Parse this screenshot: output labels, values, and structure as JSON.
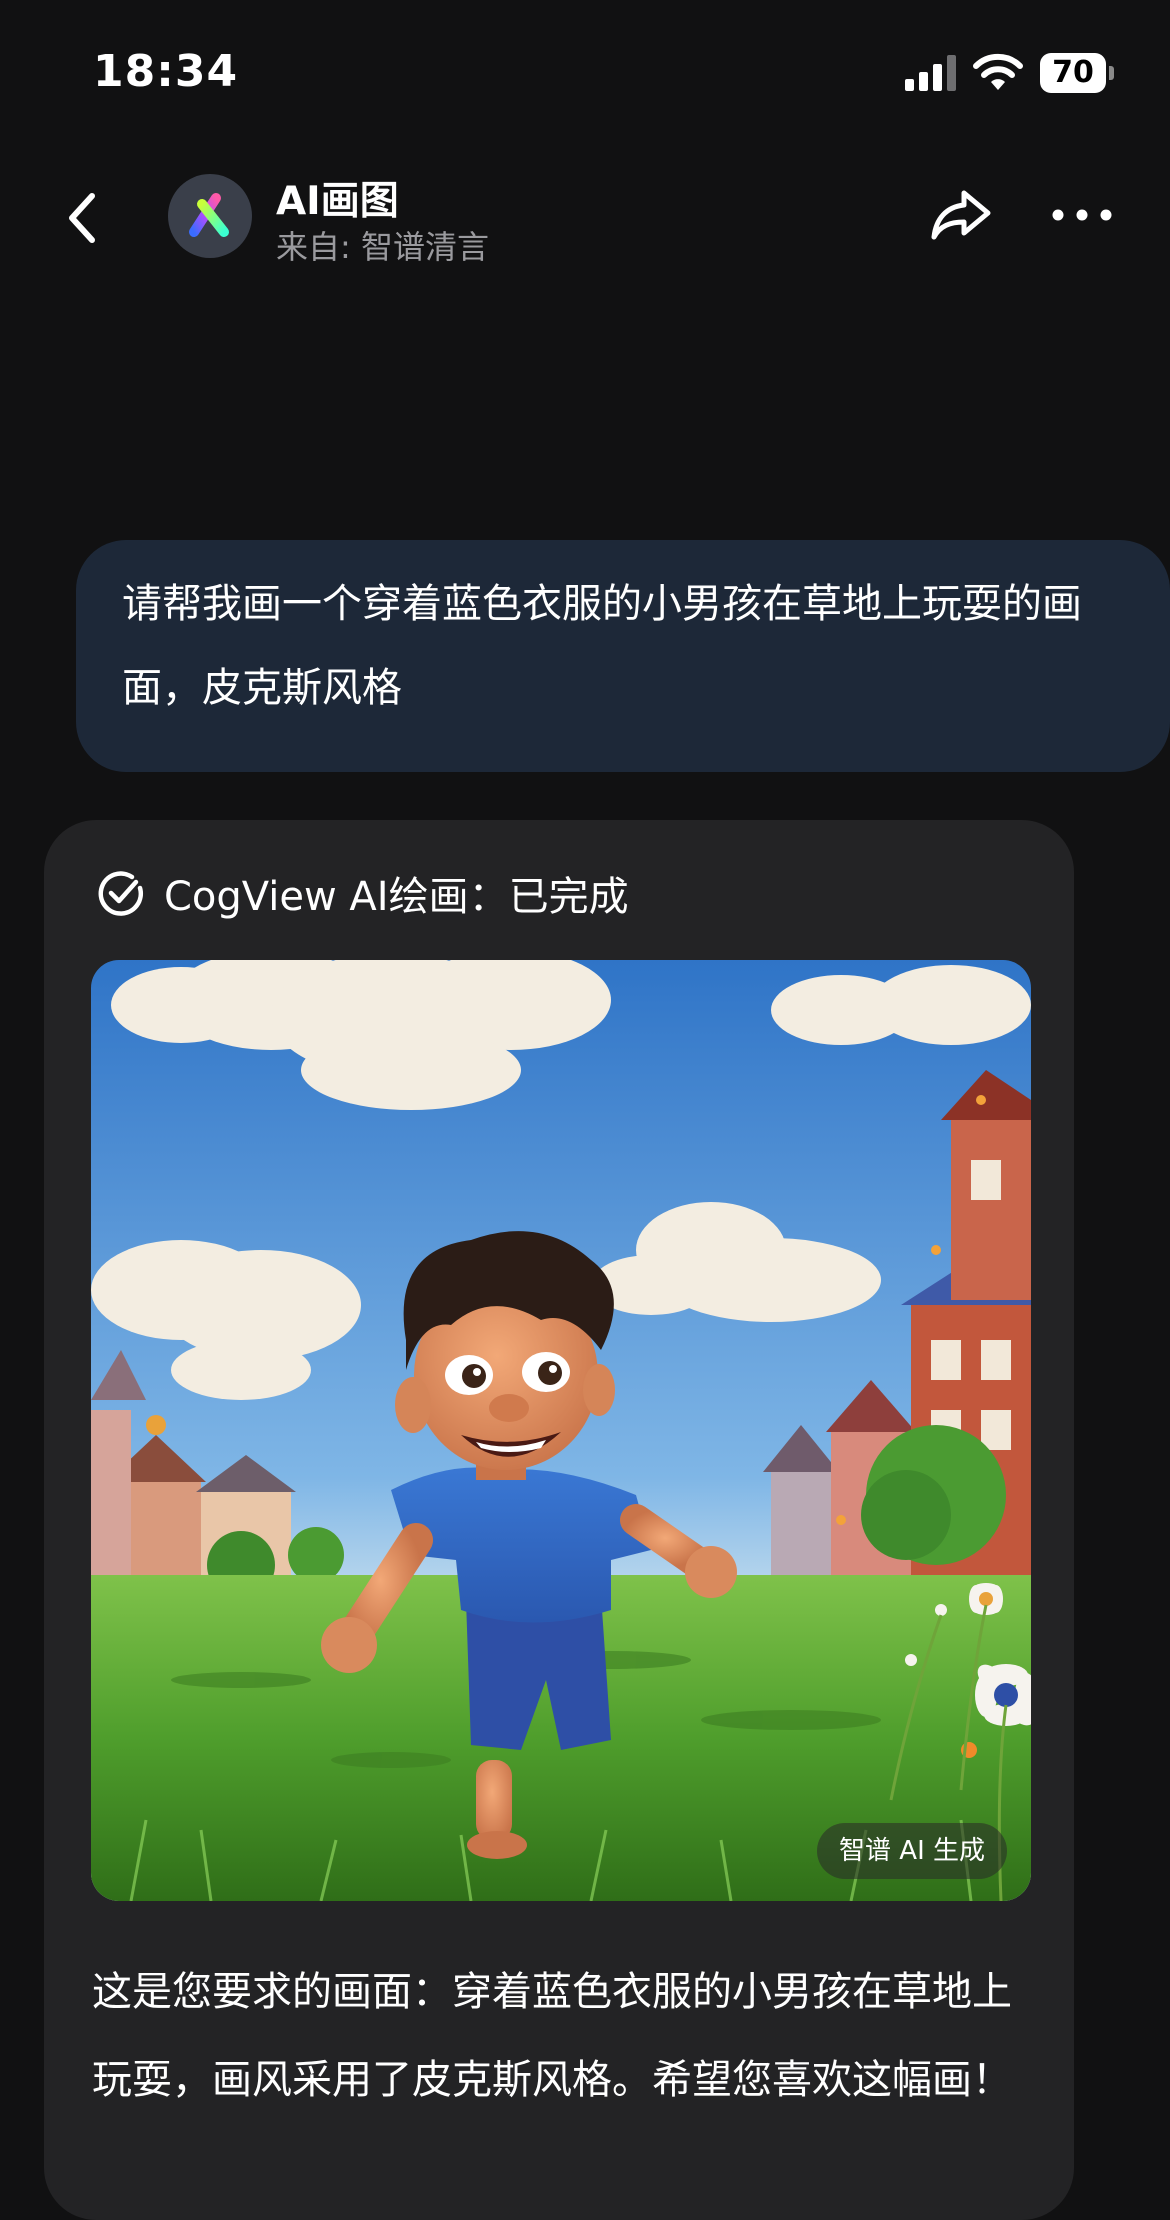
{
  "status_bar": {
    "time": "18:34",
    "battery_level": "70",
    "icons": [
      "signal-icon",
      "wifi-icon",
      "battery-icon"
    ]
  },
  "header": {
    "back_icon": "chevron-left-icon",
    "title": "AI画图",
    "source": "来自: 智谱清言",
    "share_icon": "share-icon",
    "more_icon": "more-dots-icon"
  },
  "user_message": {
    "text": "请帮我画一个穿着蓝色衣服的小男孩在草地上玩耍的画面，皮克斯风格"
  },
  "assistant_message": {
    "status_icon": "check-circle-icon",
    "status_text": "CogView AI绘画：已完成",
    "image_watermark": "智谱 AI 生成",
    "reply_text": "这是您要求的画面：穿着蓝色衣服的小男孩在草地上玩耍，画风采用了皮克斯风格。希望您喜欢这幅画！"
  },
  "colors": {
    "background": "#111112",
    "user_bubble": "#1d2838",
    "assistant_card": "#232325",
    "secondary_text": "#9a9a9e"
  }
}
